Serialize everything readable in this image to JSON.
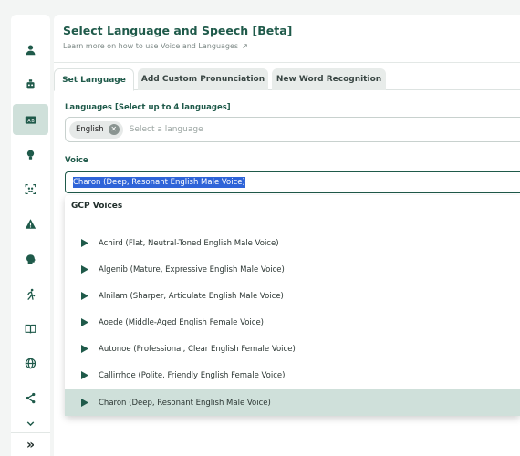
{
  "sidebar": {
    "items": [
      {
        "icon": "person-icon"
      },
      {
        "icon": "robot-icon"
      },
      {
        "icon": "translate-icon",
        "active": true
      },
      {
        "icon": "lightbulb-icon"
      },
      {
        "icon": "face-scan-icon"
      },
      {
        "icon": "warning-icon"
      },
      {
        "icon": "brain-icon"
      },
      {
        "icon": "runner-icon"
      },
      {
        "icon": "book-icon"
      },
      {
        "icon": "globe-icon"
      },
      {
        "icon": "share-icon"
      },
      {
        "icon": "chevron-down-icon"
      }
    ],
    "expand_icon": "double-chevron-right-icon",
    "expand_label": "»",
    "accent": "#1f5a4a",
    "active_bg": "#cfe0da"
  },
  "header": {
    "title": "Select Language and Speech [Beta]",
    "subtitle": "Learn more on how to use Voice and Languages",
    "subtitle_icon": "external-link-icon",
    "subtitle_arrow": "↗"
  },
  "tabs": [
    {
      "label": "Set Language",
      "active": true
    },
    {
      "label": "Add Custom Pronunciation",
      "active": false
    },
    {
      "label": "New Word Recognition",
      "active": false
    }
  ],
  "languages": {
    "label": "Languages [Select up to 4 languages]",
    "chips": [
      "English"
    ],
    "chip_remove_symbol": "✕",
    "placeholder": "Select a language"
  },
  "voice": {
    "label": "Voice",
    "value": "Charon (Deep, Resonant English Male Voice)",
    "highlight_color": "#2f64d8",
    "dropdown": {
      "group_label": "GCP Voices",
      "options": [
        {
          "label": "Achird (Flat, Neutral-Toned English Male Voice)",
          "selected": false
        },
        {
          "label": "Algenib (Mature, Expressive English Male Voice)",
          "selected": false
        },
        {
          "label": "Alnilam (Sharper, Articulate English Male Voice)",
          "selected": false
        },
        {
          "label": "Aoede (Middle-Aged English Female Voice)",
          "selected": false
        },
        {
          "label": "Autonoe (Professional, Clear English Female Voice)",
          "selected": false
        },
        {
          "label": "Callirrhoe (Polite, Friendly English Female Voice)",
          "selected": false
        },
        {
          "label": "Charon (Deep, Resonant English Male Voice)",
          "selected": true
        }
      ],
      "option_icon": "play-icon"
    }
  }
}
